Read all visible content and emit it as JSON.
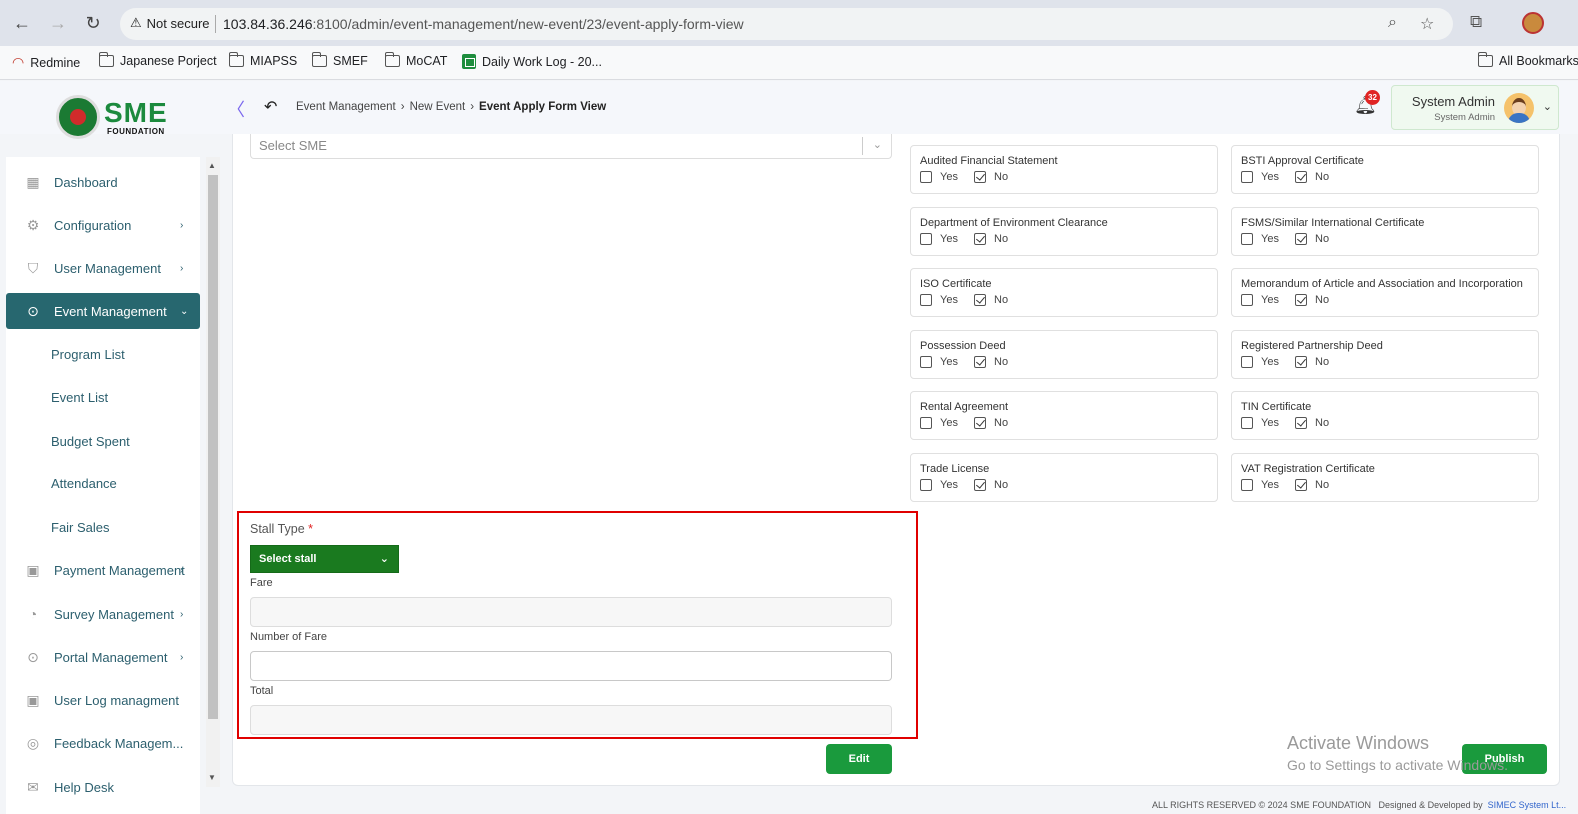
{
  "browser": {
    "security_label": "Not secure",
    "url_host": "103.84.36.246",
    "url_rest": ":8100/admin/event-management/new-event/23/event-apply-form-view",
    "bookmarks": [
      {
        "label": "Redmine"
      },
      {
        "label": "Japanese Porject"
      },
      {
        "label": "MIAPSS"
      },
      {
        "label": "SMEF"
      },
      {
        "label": "MoCAT"
      },
      {
        "label": "Daily Work Log - 20..."
      }
    ],
    "all_bookmarks": "All Bookmarks"
  },
  "header": {
    "logo_text": "SME",
    "logo_sub": "FOUNDATION",
    "breadcrumb": [
      "Event Management",
      "New Event",
      "Event Apply Form View"
    ],
    "notification_count": "32",
    "user_name": "System Admin",
    "user_role": "System Admin"
  },
  "sidebar": {
    "items": [
      {
        "label": "Dashboard",
        "icon": "dashboard-icon"
      },
      {
        "label": "Configuration",
        "icon": "configuration-icon"
      },
      {
        "label": "User Management",
        "icon": "user-shield-icon"
      },
      {
        "label": "Event Management",
        "icon": "lock-icon",
        "active": true
      },
      {
        "label": "Payment Management",
        "icon": "payment-icon"
      },
      {
        "label": "Survey Management",
        "icon": "pie-chart-icon"
      },
      {
        "label": "Portal Management",
        "icon": "lock-icon"
      },
      {
        "label": "User Log managment",
        "icon": "log-icon"
      },
      {
        "label": "Feedback Managem...",
        "icon": "feedback-icon"
      },
      {
        "label": "Help Desk",
        "icon": "mail-icon"
      }
    ],
    "sub_items": [
      "Program List",
      "Event List",
      "Budget Spent",
      "Attendance",
      "Fair Sales"
    ]
  },
  "form": {
    "select_sme_placeholder": "Select SME",
    "option_yes": "Yes",
    "option_no": "No",
    "documents": [
      {
        "label": "Audited Financial Statement",
        "value": "No"
      },
      {
        "label": "BSTI Approval Certificate",
        "value": "No"
      },
      {
        "label": "Department of Environment Clearance",
        "value": "No"
      },
      {
        "label": "FSMS/Similar International Certificate",
        "value": "No"
      },
      {
        "label": "ISO Certificate",
        "value": "No"
      },
      {
        "label": "Memorandum of Article and Association and Incorporation",
        "value": "No"
      },
      {
        "label": "Possession Deed",
        "value": "No"
      },
      {
        "label": "Registered Partnership Deed",
        "value": "No"
      },
      {
        "label": "Rental Agreement",
        "value": "No"
      },
      {
        "label": "TIN Certificate",
        "value": "No"
      },
      {
        "label": "Trade License",
        "value": "No"
      },
      {
        "label": "VAT Registration Certificate",
        "value": "No"
      }
    ],
    "stall_type_label": "Stall Type",
    "required_mark": "*",
    "stall_placeholder": "Select stall",
    "fare_label": "Fare",
    "fare_value": "",
    "number_of_fare_label": "Number of Fare",
    "number_of_fare_value": "",
    "total_label": "Total",
    "total_value": "",
    "edit_label": "Edit",
    "publish_label": "Publish"
  },
  "watermark": {
    "title": "Activate Windows",
    "subtitle": "Go to Settings to activate Windows."
  },
  "footer": {
    "rights": "ALL RIGHTS RESERVED © 2024 SME FOUNDATION",
    "designed_by": "Designed & Developed by",
    "developer": "SIMEC System Lt..."
  },
  "colors": {
    "sidebar_active": "#27676f",
    "stall_select_bg": "#1a7a1f",
    "button_green": "#1a9a3d",
    "highlight_border": "#e00000",
    "badge_red": "#e02424"
  }
}
